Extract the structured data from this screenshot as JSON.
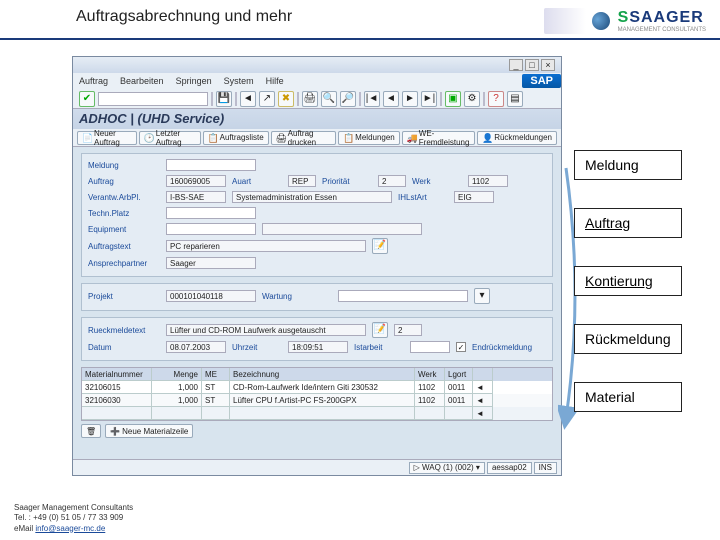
{
  "slide": {
    "title": "Auftragsabrechnung und mehr",
    "company": "SAAGER",
    "company_sub": "MANAGEMENT CONSULTANTS"
  },
  "sap": {
    "menu": [
      "Auftrag",
      "Bearbeiten",
      "Springen",
      "System",
      "Hilfe"
    ],
    "brand": "SAP",
    "app_title": "ADHOC |    (UHD Service)",
    "app_toolbar": [
      {
        "label": "Neuer Auftrag",
        "icon": "📄"
      },
      {
        "label": "Letzter Auftrag",
        "icon": "🕑"
      },
      {
        "label": "Auftragsliste",
        "icon": "📋"
      },
      {
        "label": "Auftrag drucken",
        "icon": "🖨"
      },
      {
        "label": "Meldungen",
        "icon": "📋"
      },
      {
        "label": "WE-Fremdleistung",
        "icon": "🚚"
      },
      {
        "label": "Rückmeldungen",
        "icon": "👤"
      }
    ],
    "fields": {
      "meldung_label": "Meldung",
      "meldung": "",
      "auftrag_label": "Auftrag",
      "auftrag": "160069005",
      "auart_label": "Auart",
      "auart": "REP",
      "prio_label": "Priorität",
      "prio": "2",
      "werk_label": "Werk",
      "werk": "1102",
      "verantw_label": "Verantw.ArbPl.",
      "verantw_code": "I-BS-SAE",
      "verantw_text": "Systemadministration Essen",
      "ihlstart_label": "IHLstArt",
      "ihlstart": "EIG",
      "technplatz_label": "Techn.Platz",
      "technplatz": "",
      "equipment_label": "Equipment",
      "equipment": "",
      "auftragstext_label": "Auftragstext",
      "auftragstext": "PC reparieren",
      "ansprech_label": "Ansprechpartner",
      "ansprech": "Saager",
      "projekt_label": "Projekt",
      "projekt": "000101040118",
      "wartung_label": "Wartung",
      "wartung": "",
      "rueck_label": "Rueckmeldetext",
      "rueck": "Lüfter und CD-ROM Laufwerk ausgetauscht",
      "rueck_count": "2",
      "datum_label": "Datum",
      "datum": "08.07.2003",
      "uhrzeit_label": "Uhrzeit",
      "uhrzeit": "18:09:51",
      "istarbeit_label": "Istarbeit",
      "istarbeit": "",
      "endrueck_label": "Endrückmeldung"
    },
    "mat": {
      "headers": [
        "Materialnummer",
        "Menge",
        "ME",
        "Bezeichnung",
        "Werk",
        "Lgort"
      ],
      "rows": [
        {
          "num": "32106015",
          "qty": "1,000",
          "me": "ST",
          "desc": "CD-Rom-Laufwerk Ide/intern Giti 230532",
          "plant": "1102",
          "stor": "0011"
        },
        {
          "num": "32106030",
          "qty": "1,000",
          "me": "ST",
          "desc": "Lüfter CPU f.Artist-PC FS-200GPX",
          "plant": "1102",
          "stor": "0011"
        }
      ],
      "new_row": "Neue Materialzeile"
    },
    "status": {
      "conn": "WAQ (1) (002)",
      "server": "aessap02",
      "mode": "INS"
    }
  },
  "overlays": [
    "Meldung",
    "Auftrag",
    "Kontierung",
    "Rückmeldung",
    "Material"
  ],
  "footer": {
    "company": "Saager Management Consultants",
    "tel": "Tel. : +49 (0) 51 05 / 77 33 909",
    "email_label": "eMail ",
    "email": "info@saager-mc.de"
  }
}
